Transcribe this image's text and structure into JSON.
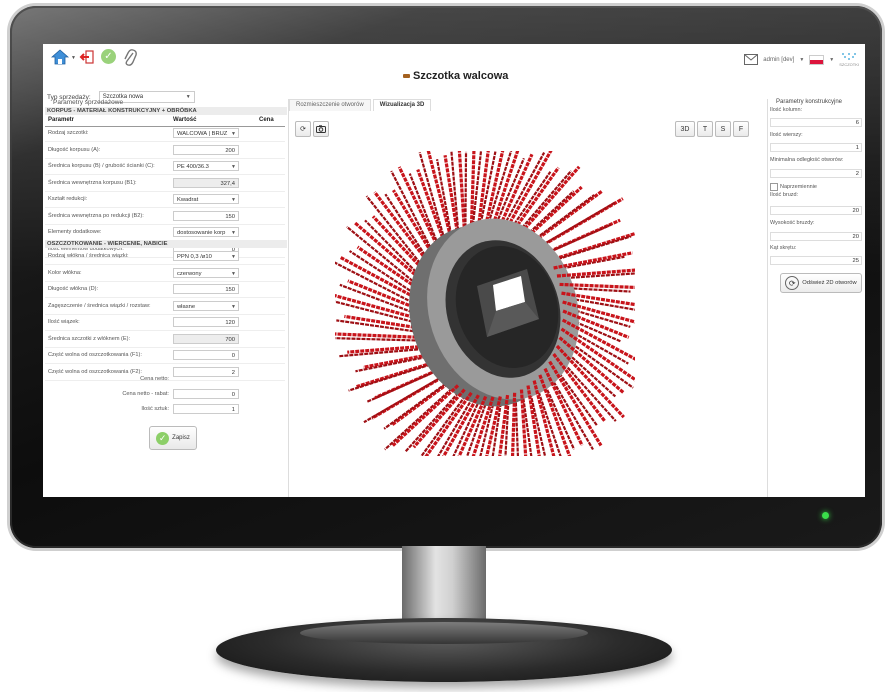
{
  "app": {
    "title": "Szczotka walcowa"
  },
  "header": {
    "user_label": "admin [dev]",
    "logo_text": "SZCZOTKI"
  },
  "sale": {
    "label": "Typ sprzedaży:",
    "value": "Szczotka nowa"
  },
  "left_panel": {
    "section_title": "Parametry sprzedażowe",
    "section1_header": "KORPUS - MATERIAŁ KONSTRUKCYJNY + OBRÓBKA",
    "columns": {
      "param": "Parametr",
      "value": "Wartość",
      "price": "Cena"
    },
    "rows1": [
      {
        "label": "Rodzaj szczotki:",
        "value": "WALCOWA | BRUZ"
      },
      {
        "label": "Długość korpusu (A):",
        "value": "200"
      },
      {
        "label": "Średnica korpusu (B) / grubość ścianki (C):",
        "value": "PE 400/36.3"
      },
      {
        "label": "Średnica wewnętrzna korpusu (B1):",
        "value": "327,4"
      },
      {
        "label": "Kształt redukcji:",
        "value": "Kwadrat"
      },
      {
        "label": "Średnica wewnętrzna po redukcji (B2):",
        "value": "150"
      },
      {
        "label": "Elementy dodatkowe:",
        "value": "dostosowanie korp"
      },
      {
        "label": "Ilość elementów dodatkowych:",
        "value": "0"
      }
    ],
    "section2_header": "OSZCZOTKOWANIE - WIERCENIE, NABICIE",
    "rows2": [
      {
        "label": "Rodzaj włókna / średnica wiązki:",
        "value": "PPN 0,3 /ø10"
      },
      {
        "label": "Kolor włókna:",
        "value": "czerwony"
      },
      {
        "label": "Długość włókna (D):",
        "value": "150"
      },
      {
        "label": "Zagęszczenie / średnica wiązki / rozstaw:",
        "value": "własne"
      },
      {
        "label": "Ilość wiązek:",
        "value": "120"
      },
      {
        "label": "Średnica szczotki z włóknem (E):",
        "value": "700"
      },
      {
        "label": "Część wolna od oszczotkowania (F1):",
        "value": "0"
      },
      {
        "label": "Część wolna od oszczotkowania (F2):",
        "value": "2"
      }
    ],
    "net_price_label": "Cena netto:",
    "net_discount_label": "Cena netto - rabat:",
    "net_discount_value": "0",
    "qty_label": "Ilość sztuk:",
    "qty_value": "1",
    "save_label": "Zapisz"
  },
  "center": {
    "tabs": [
      "Rozmieszczenie otworów",
      "Wizualizacja 3D"
    ],
    "views": [
      "3D",
      "T",
      "S",
      "F"
    ]
  },
  "right_panel": {
    "title": "Parametry konstrukcyjne",
    "fields": [
      {
        "label": "Ilość kolumn:",
        "value": "6"
      },
      {
        "label": "Ilość wierszy:",
        "value": "1"
      },
      {
        "label": "Minimalna odległość otworów:",
        "value": "2"
      }
    ],
    "checkbox_label": "Naprzemiennie",
    "fields2": [
      {
        "label": "Ilość bruzd:",
        "value": "20"
      },
      {
        "label": "Wysokość bruzdy:",
        "value": "20"
      },
      {
        "label": "Kąt skrętu:",
        "value": "25"
      }
    ],
    "refresh_label": "Odśwież 2D otworów"
  },
  "colors": {
    "bristle": "#c8141b",
    "hub": "#8a8a8a",
    "accent": "#a4611f"
  }
}
